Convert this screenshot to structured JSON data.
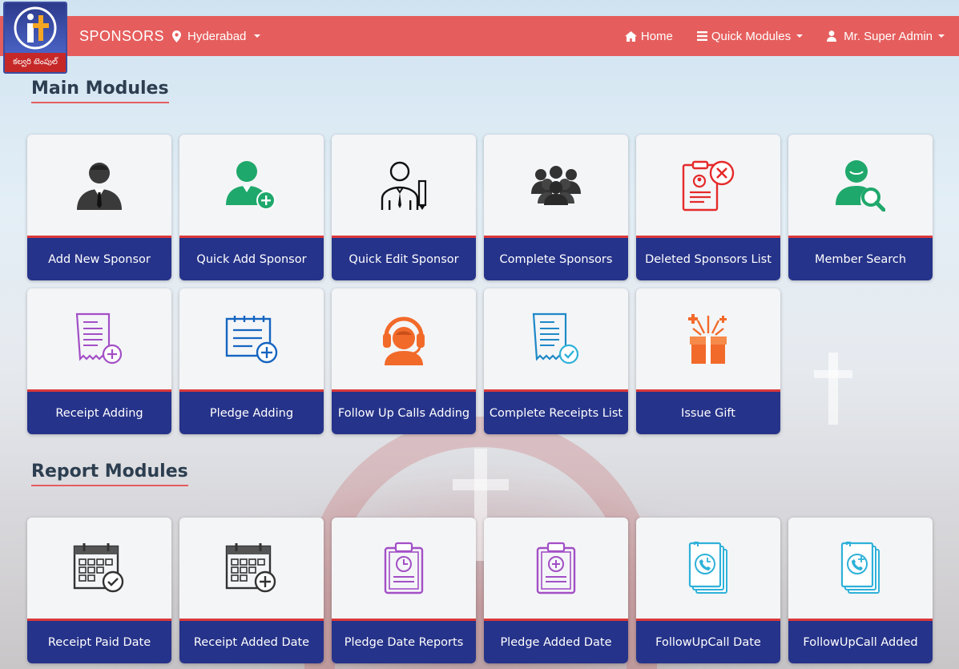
{
  "header": {
    "brand": "SPONSORS",
    "city": "Hyderabad",
    "nav": {
      "home": "Home",
      "quick_modules": "Quick Modules",
      "user": "Mr. Super Admin"
    },
    "logo_text": "కల్వరి టెంపుల్"
  },
  "sections": {
    "main_title": "Main Modules",
    "report_title": "Report Modules"
  },
  "main_modules": [
    {
      "label": "Add New Sponsor",
      "icon": "businessman-icon"
    },
    {
      "label": "Quick Add Sponsor",
      "icon": "user-add-icon"
    },
    {
      "label": "Quick Edit Sponsor",
      "icon": "user-edit-icon"
    },
    {
      "label": "Complete Sponsors",
      "icon": "group-icon"
    },
    {
      "label": "Deleted Sponsors List",
      "icon": "deleted-list-icon"
    },
    {
      "label": "Member Search",
      "icon": "member-search-icon"
    },
    {
      "label": "Receipt Adding",
      "icon": "receipt-add-icon"
    },
    {
      "label": "Pledge Adding",
      "icon": "pledge-add-icon"
    },
    {
      "label": "Follow Up Calls Adding",
      "icon": "headset-icon"
    },
    {
      "label": "Complete Receipts List",
      "icon": "receipt-check-icon"
    },
    {
      "label": "Issue Gift",
      "icon": "gift-icon"
    }
  ],
  "report_modules": [
    {
      "label": "Receipt Paid Date",
      "icon": "calendar-check-icon"
    },
    {
      "label": "Receipt Added Date",
      "icon": "calendar-add-icon"
    },
    {
      "label": "Pledge Date Reports",
      "icon": "clipboard-clock-icon"
    },
    {
      "label": "Pledge Added Date",
      "icon": "clipboard-add-icon"
    },
    {
      "label": "FollowUpCall Date",
      "icon": "call-clock-icon"
    },
    {
      "label": "FollowUpCall Added",
      "icon": "call-add-icon"
    }
  ],
  "colors": {
    "navbar": "#e55e5d",
    "card_label_bg": "#26338a",
    "card_accent": "#d9383a",
    "icon_green": "#1fa86b",
    "icon_purple": "#a24fc6",
    "icon_blue": "#1565c0",
    "icon_orange": "#f26a2a",
    "icon_cyan": "#2fb1d9",
    "icon_red": "#e52a2a"
  }
}
